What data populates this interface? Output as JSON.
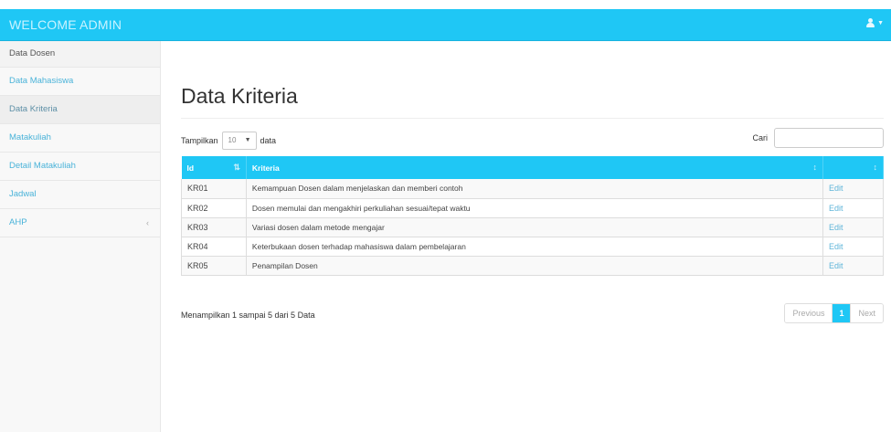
{
  "navbar": {
    "brand": "WELCOME ADMIN",
    "user_icon": "user-icon"
  },
  "sidebar": {
    "items": [
      {
        "label": "Data Dosen"
      },
      {
        "label": "Data Mahasiswa"
      },
      {
        "label": "Data Kriteria"
      },
      {
        "label": "Matakuliah"
      },
      {
        "label": "Detail Matakuliah"
      },
      {
        "label": "Jadwal"
      },
      {
        "label": "AHP",
        "arrow": "‹"
      }
    ]
  },
  "page": {
    "title": "Data Kriteria"
  },
  "controls": {
    "show_label": "Tampilkan",
    "length_value": "10",
    "data_label": "data",
    "search_label": "Cari"
  },
  "table": {
    "columns": [
      "Id",
      "Kriteria",
      ""
    ],
    "rows": [
      {
        "id": "KR01",
        "kriteria": "Kemampuan Dosen dalam menjelaskan dan memberi contoh",
        "action": "Edit"
      },
      {
        "id": "KR02",
        "kriteria": "Dosen memulai dan mengakhiri perkuliahan sesuai/tepat waktu",
        "action": "Edit"
      },
      {
        "id": "KR03",
        "kriteria": "Variasi dosen dalam metode mengajar",
        "action": "Edit"
      },
      {
        "id": "KR04",
        "kriteria": "Keterbukaan dosen terhadap mahasiswa dalam pembelajaran",
        "action": "Edit"
      },
      {
        "id": "KR05",
        "kriteria": "Penampilan Dosen",
        "action": "Edit"
      }
    ]
  },
  "footer": {
    "info": "Menampilkan 1 sampai 5 dari 5 Data",
    "pager": {
      "previous": "Previous",
      "current": "1",
      "next": "Next"
    }
  },
  "colors": {
    "accent": "#1fc7f5",
    "link": "#4ab3d9"
  }
}
